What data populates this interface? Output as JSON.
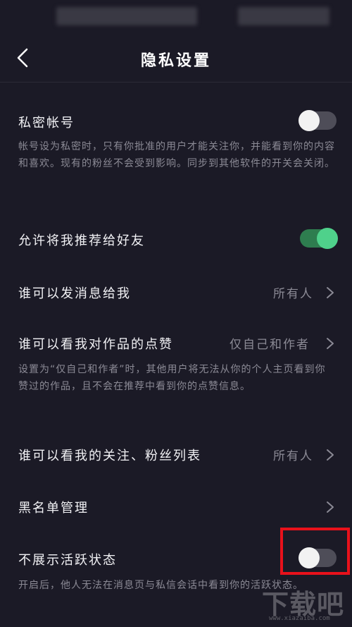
{
  "header": {
    "title": "隐私设置"
  },
  "settings": {
    "private_account": {
      "label": "私密帐号",
      "description": "帐号设为私密时，只有你批准的用户才能关注你，并能看到你的内容和喜欢。现有的粉丝不会受到影响。同步到其他软件的开关会关闭。",
      "toggle_on": false
    },
    "recommend": {
      "label": "允许将我推荐给好友",
      "toggle_on": true
    },
    "messages": {
      "label": "谁可以发消息给我",
      "value": "所有人"
    },
    "likes": {
      "label": "谁可以看我对作品的点赞",
      "value": "仅自己和作者",
      "description": "设置为“仅自己和作者”时，其他用户将无法从你的个人主页看到你赞过的作品，且不会在推荐中看到你的点赞信息。"
    },
    "follow_list": {
      "label": "谁可以看我的关注、粉丝列表",
      "value": "所有人"
    },
    "blacklist": {
      "label": "黑名单管理"
    },
    "activity_status": {
      "label": "不展示活跃状态",
      "description": "开启后，他人无法在消息页与私信会话中看到你的活跃状态。",
      "toggle_on": false
    }
  },
  "watermark": {
    "brand": "下载吧",
    "url": "www.xiazaiba.com"
  },
  "colors": {
    "background": "#1b1a26",
    "toggle_on": "#4fd18b",
    "highlight": "#e8111b"
  }
}
